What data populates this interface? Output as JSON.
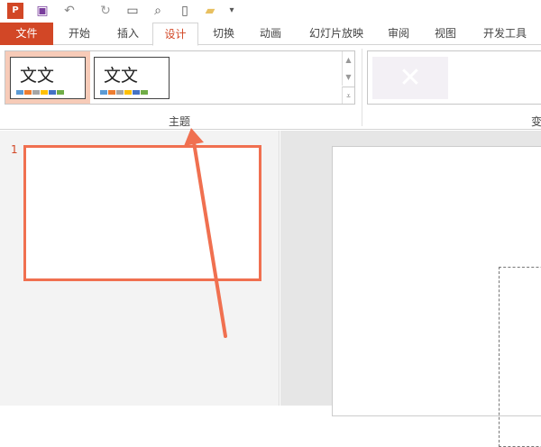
{
  "quick_access": {
    "icons": [
      "powerpoint-logo",
      "save-icon",
      "undo-icon",
      "redo-icon",
      "slideshow-icon",
      "print-preview-icon",
      "new-icon",
      "open-icon",
      "customize-icon"
    ]
  },
  "tabs": [
    {
      "label": "文件"
    },
    {
      "label": "开始"
    },
    {
      "label": "插入"
    },
    {
      "label": "设计"
    },
    {
      "label": "切换"
    },
    {
      "label": "动画"
    },
    {
      "label": "幻灯片放映"
    },
    {
      "label": "审阅"
    },
    {
      "label": "视图"
    },
    {
      "label": "开发工具"
    }
  ],
  "ribbon": {
    "themes": [
      {
        "text": "文文"
      },
      {
        "text": "文文"
      }
    ],
    "group_label": "主题",
    "variants_label": "变"
  },
  "slides": {
    "number": "1"
  },
  "colors": {
    "accent": "#d24726",
    "annotation": "#f07050"
  }
}
